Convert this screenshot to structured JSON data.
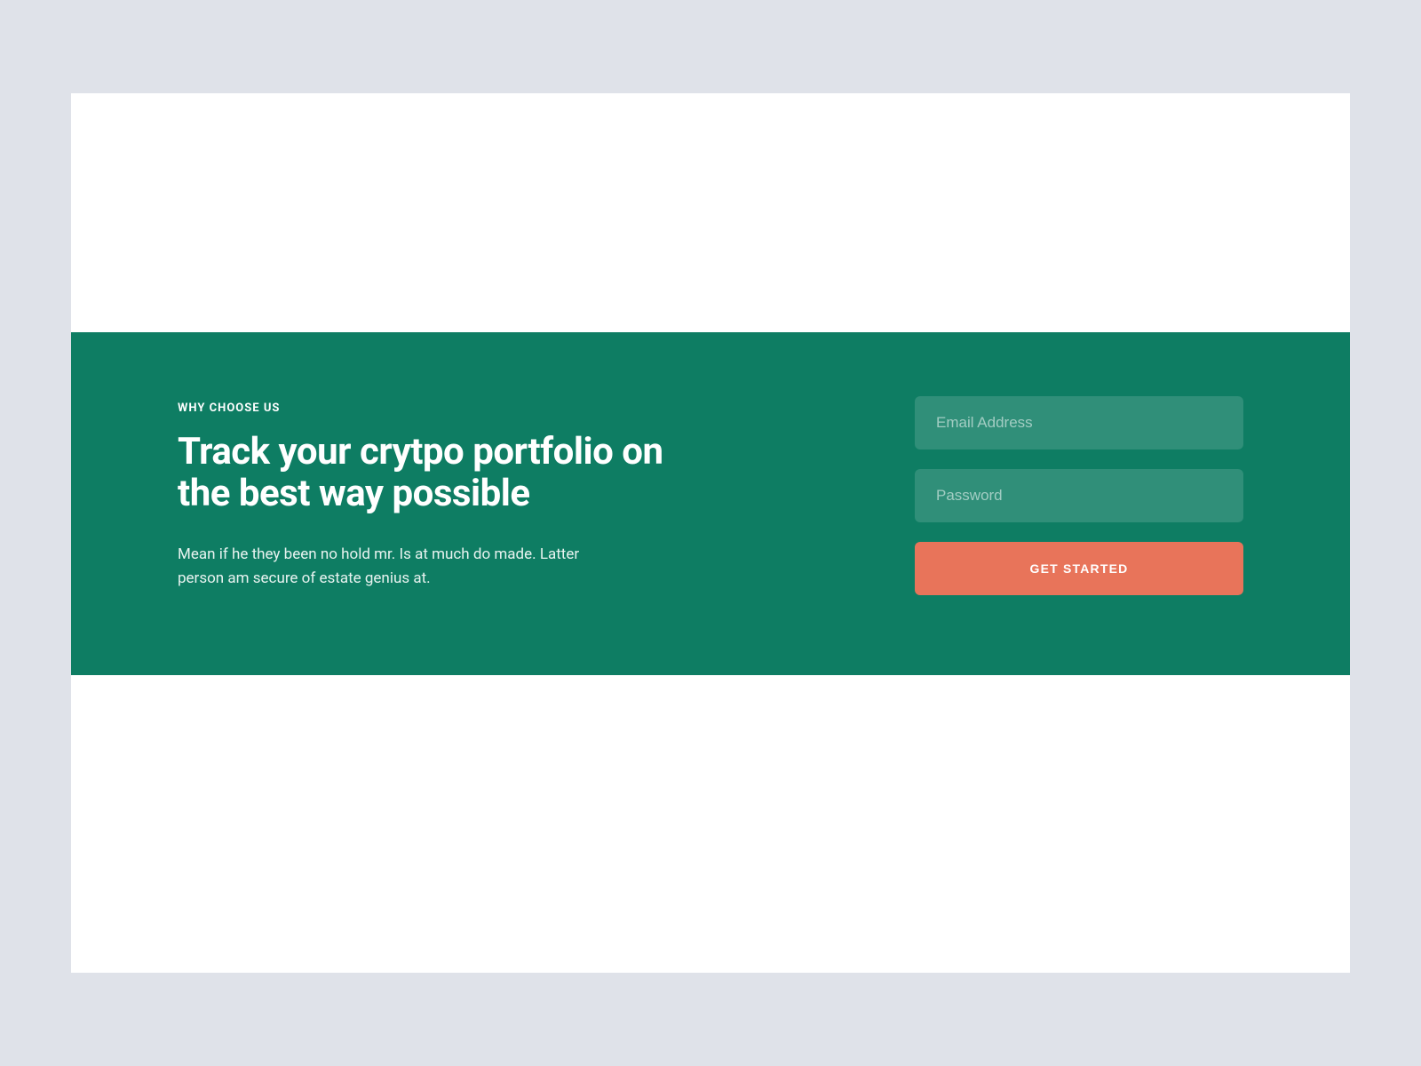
{
  "hero": {
    "overline": "WHY CHOOSE US",
    "title": "Track your crytpo portfolio on the best way possible",
    "description": "Mean if he they been no hold mr. Is at much do made. Latter person am secure of estate genius at."
  },
  "form": {
    "email_placeholder": "Email Address",
    "password_placeholder": "Password",
    "submit_label": "GET STARTED"
  },
  "colors": {
    "background": "#dfe2e9",
    "hero_bg": "#0e7d63",
    "cta": "#e8745a"
  }
}
